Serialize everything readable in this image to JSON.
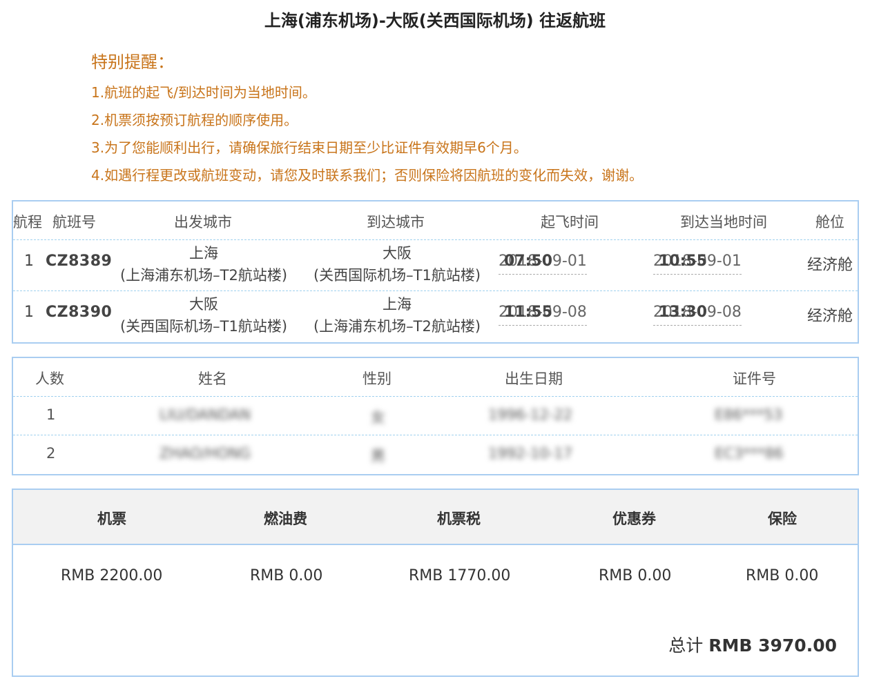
{
  "title": "上海(浦东机场)-大阪(关西国际机场)  往返航班",
  "notice": {
    "title": "特别提醒：",
    "items": [
      "1.航班的起飞/到达时间为当地时间。",
      "2.机票须按预订航程的顺序使用。",
      "3.为了您能顺利出行，请确保旅行结束日期至少比证件有效期早6个月。",
      "4.如遇行程更改或航班变动，请您及时联系我们；否则保险将因航班的变化而失效，谢谢。"
    ]
  },
  "flights": {
    "headers": [
      "航程",
      "航班号",
      "出发城市",
      "到达城市",
      "起飞时间",
      "到达当地时间",
      "舱位"
    ],
    "rows": [
      {
        "leg": "1",
        "flight_no": "CZ8389",
        "from_city": "上海",
        "from_airport": "(上海浦东机场–T2航站楼)",
        "to_city": "大阪",
        "to_airport": "(关西国际机场–T1航站楼)",
        "dep_date": "2018-09-01",
        "dep_time": "07:50",
        "arr_date": "2018-09-01",
        "arr_time": "10:55",
        "cabin": "经济舱"
      },
      {
        "leg": "1",
        "flight_no": "CZ8390",
        "from_city": "大阪",
        "from_airport": "(关西国际机场–T1航站楼)",
        "to_city": "上海",
        "to_airport": "(上海浦东机场–T2航站楼)",
        "dep_date": "2018-09-08",
        "dep_time": "11:55",
        "arr_date": "2018-09-08",
        "arr_time": "13:30",
        "cabin": "经济舱"
      }
    ]
  },
  "passengers": {
    "headers": [
      "人数",
      "姓名",
      "性别",
      "出生日期",
      "证件号"
    ],
    "rows": [
      {
        "index": "1",
        "name": "LIU/DANDAN",
        "gender": "女",
        "birth": "1996-12-22",
        "id": "E86***53"
      },
      {
        "index": "2",
        "name": "ZHAO/HONG",
        "gender": "男",
        "birth": "1992-10-17",
        "id": "EC3***86"
      }
    ]
  },
  "price": {
    "headers": [
      "机票",
      "燃油费",
      "机票税",
      "优惠券",
      "保险"
    ],
    "values": [
      "RMB 2200.00",
      "RMB 0.00",
      "RMB 1770.00",
      "RMB 0.00",
      "RMB 0.00"
    ],
    "total_label": "总计",
    "total_value": "RMB 3970.00"
  }
}
